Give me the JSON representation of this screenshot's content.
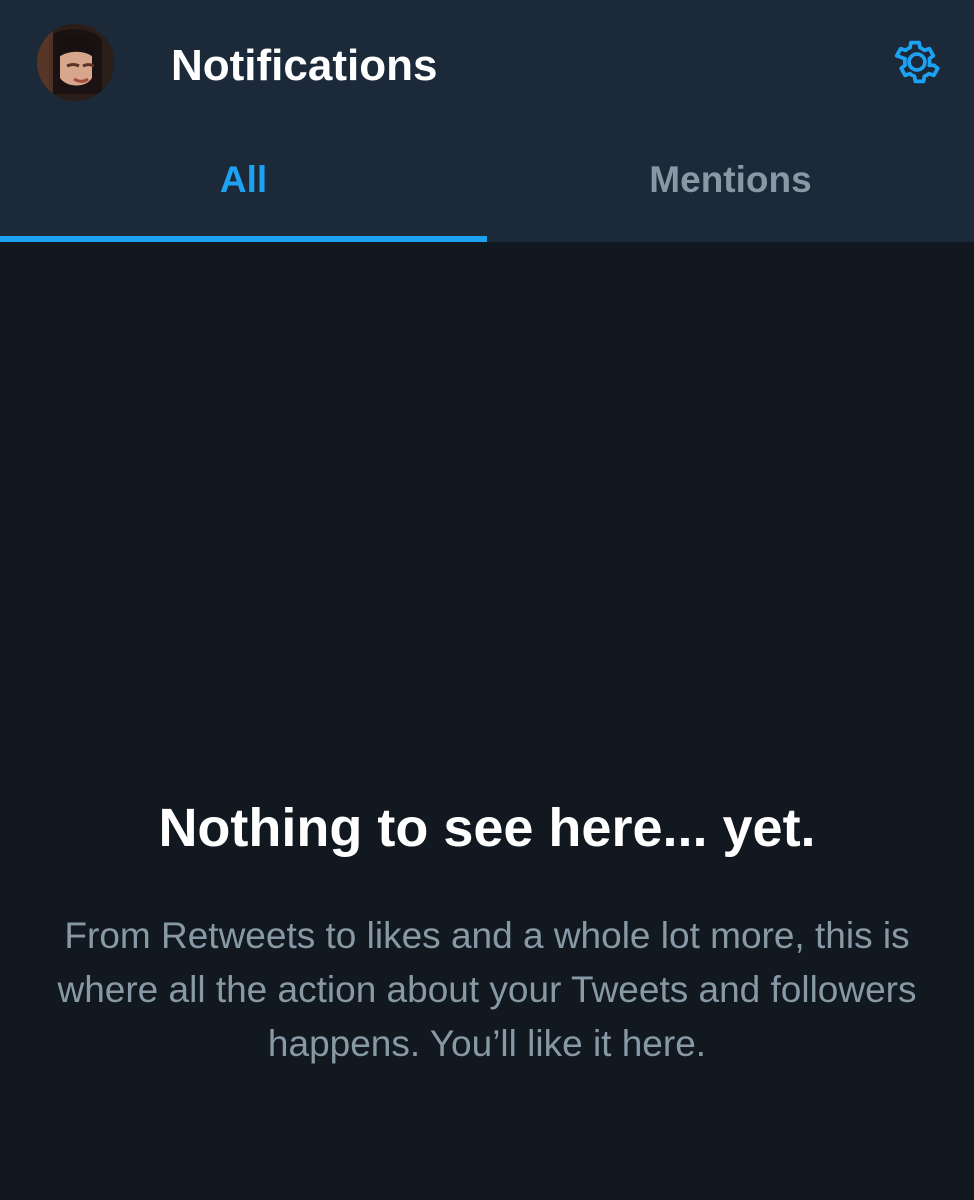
{
  "header": {
    "title": "Notifications",
    "avatar_icon": "profile-avatar",
    "settings_icon": "gear-icon"
  },
  "tabs": [
    {
      "label": "All",
      "active": true
    },
    {
      "label": "Mentions",
      "active": false
    }
  ],
  "empty_state": {
    "title": "Nothing to see here... yet.",
    "body": "From Retweets to likes and a whole lot more, this is where all the action about your Tweets and followers happens. You’ll like it here."
  },
  "colors": {
    "accent": "#1da1f2",
    "header_bg": "#1c2938",
    "page_bg": "#121820",
    "muted_text": "#8899a6",
    "primary_text": "#ffffff"
  }
}
